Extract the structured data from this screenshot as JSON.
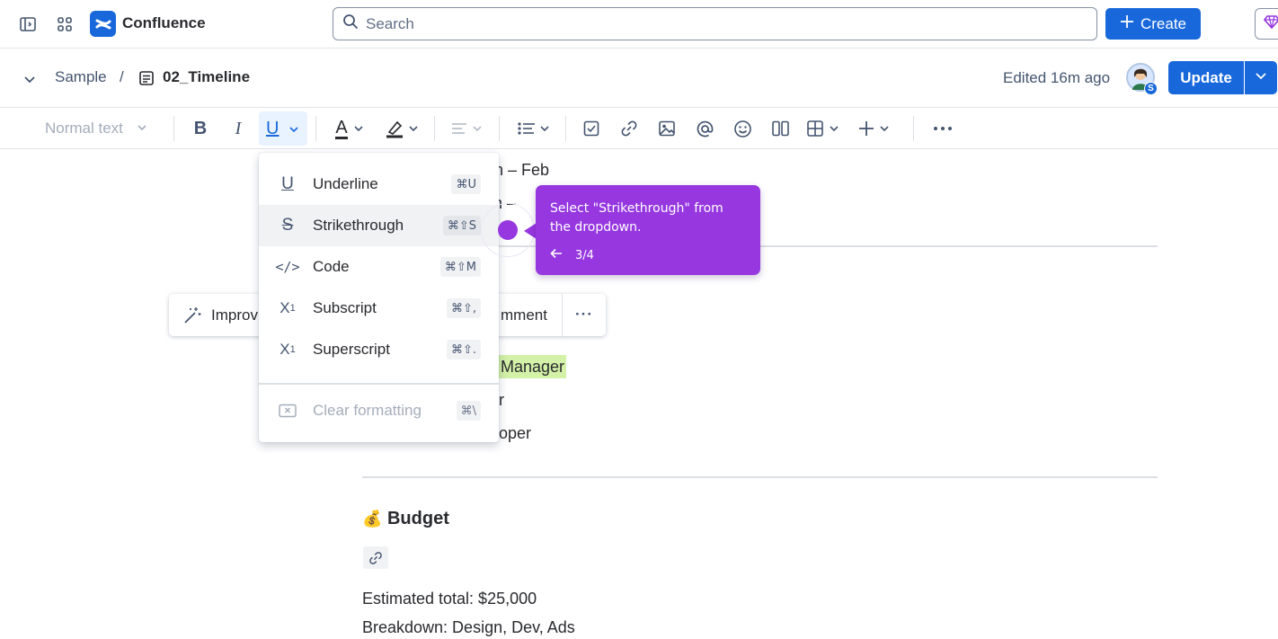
{
  "app": {
    "name": "Confluence"
  },
  "search": {
    "placeholder": "Search"
  },
  "create_label": "Create",
  "breadcrumb": {
    "space": "Sample",
    "separator": "/",
    "page": "02_Timeline"
  },
  "page_header": {
    "edited": "Edited 16m ago",
    "avatar_badge": "S",
    "update_label": "Update"
  },
  "toolbar": {
    "text_style": "Normal text",
    "bold": "B",
    "italic": "I",
    "underline": "U",
    "text_color": "A"
  },
  "document": {
    "line1": "gn – Feb",
    "line2": "ch –",
    "role1": "Manager",
    "role2": "r",
    "role3": "oper",
    "budget_emoji": "💰",
    "budget_heading": "Budget",
    "estimated": "Estimated total: $25,000",
    "breakdown": "Breakdown: Design, Dev, Ads"
  },
  "floating_toolbar": {
    "improve": "Improv",
    "comment": "mment",
    "more": "···"
  },
  "underline_menu": {
    "items": [
      {
        "icon": "underline-icon",
        "label": "Underline",
        "shortcut": "⌘U"
      },
      {
        "icon": "strikethrough-icon",
        "label": "Strikethrough",
        "shortcut": "⌘⇧S"
      },
      {
        "icon": "code-icon",
        "label": "Code",
        "shortcut": "⌘⇧M"
      },
      {
        "icon": "subscript-icon",
        "label": "Subscript",
        "shortcut": "⌘⇧,"
      },
      {
        "icon": "superscript-icon",
        "label": "Superscript",
        "shortcut": "⌘⇧."
      }
    ],
    "clear": {
      "icon": "clear-formatting-icon",
      "label": "Clear formatting",
      "shortcut": "⌘\\"
    }
  },
  "guide": {
    "text": "Select \"Strikethrough\" from the dropdown.",
    "step": "3/4"
  },
  "colors": {
    "brand": "#1868db",
    "guide": "#9637e0",
    "highlight": "#d3f1a7"
  }
}
